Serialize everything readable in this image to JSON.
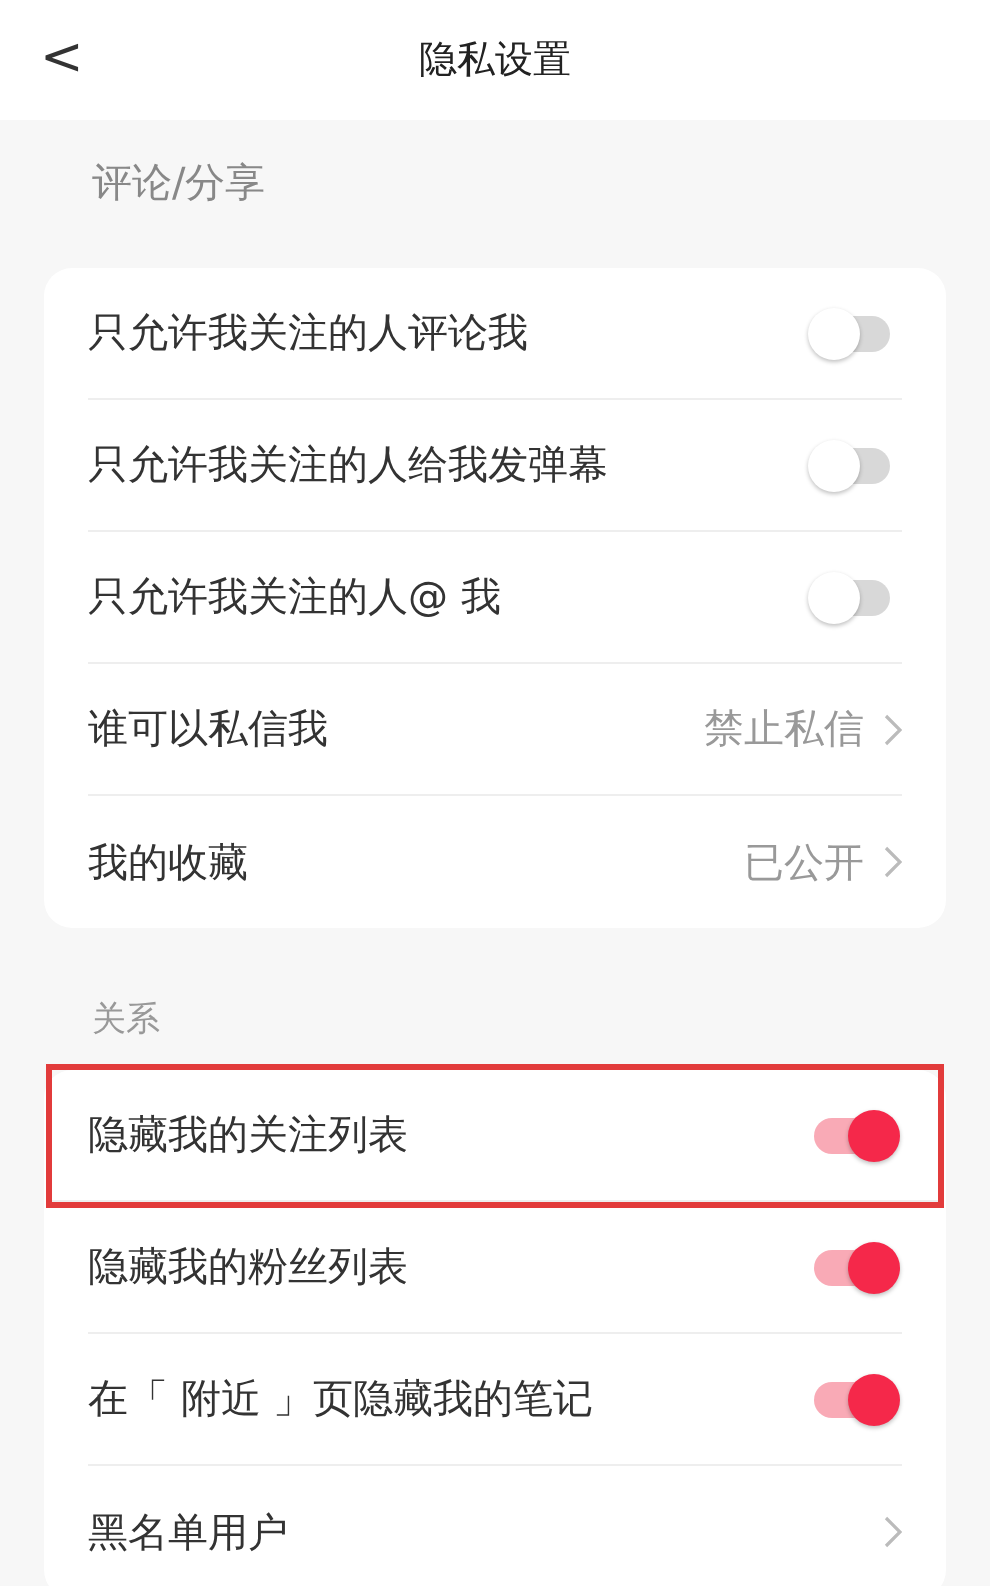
{
  "header": {
    "back": "<",
    "title": "隐私设置"
  },
  "note": "评论/分享",
  "groups": [
    {
      "items": [
        {
          "kind": "toggle",
          "label": "只允许我关注的人评论我",
          "on": false,
          "highlighted": false
        },
        {
          "kind": "toggle",
          "label": "只允许我关注的人给我发弹幕",
          "on": false,
          "highlighted": false
        },
        {
          "kind": "toggle",
          "label": "只允许我关注的人@ 我",
          "on": false,
          "highlighted": false
        },
        {
          "kind": "link",
          "label": "谁可以私信我",
          "value": "禁止私信",
          "highlighted": false
        },
        {
          "kind": "link",
          "label": "我的收藏",
          "value": "已公开",
          "highlighted": false
        }
      ]
    },
    {
      "title": "关系",
      "items": [
        {
          "kind": "toggle",
          "label": "隐藏我的关注列表",
          "on": true,
          "highlighted": true
        },
        {
          "kind": "toggle",
          "label": "隐藏我的粉丝列表",
          "on": true,
          "highlighted": false
        },
        {
          "kind": "toggle",
          "label": "在「 附近 」页隐藏我的笔记",
          "on": true,
          "highlighted": false
        },
        {
          "kind": "link",
          "label": "黑名单用户",
          "highlighted": false
        }
      ]
    }
  ]
}
